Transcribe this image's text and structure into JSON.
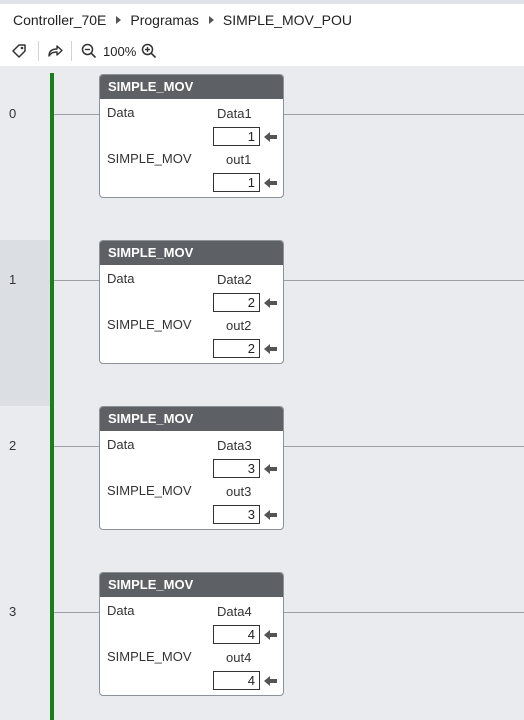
{
  "breadcrumb": [
    "Controller_70E",
    "Programas",
    "SIMPLE_MOV_POU"
  ],
  "toolbar": {
    "zoom": "100%",
    "icons": [
      "tag-icon",
      "go-to-icon",
      "zoom-out-icon",
      "zoom-in-icon"
    ]
  },
  "colors": {
    "rail": "#1a7f1a",
    "block_header": "#5d6064",
    "canvas": "#e9ebee"
  },
  "rungs": [
    {
      "number": "0",
      "block": {
        "title": "SIMPLE_MOV",
        "in_label": "Data",
        "name_label": "SIMPLE_MOV",
        "param1": "Data1",
        "value1": "1",
        "param2": "out1",
        "value2": "1"
      }
    },
    {
      "number": "1",
      "block": {
        "title": "SIMPLE_MOV",
        "in_label": "Data",
        "name_label": "SIMPLE_MOV",
        "param1": "Data2",
        "value1": "2",
        "param2": "out2",
        "value2": "2"
      }
    },
    {
      "number": "2",
      "block": {
        "title": "SIMPLE_MOV",
        "in_label": "Data",
        "name_label": "SIMPLE_MOV",
        "param1": "Data3",
        "value1": "3",
        "param2": "out3",
        "value2": "3"
      }
    },
    {
      "number": "3",
      "block": {
        "title": "SIMPLE_MOV",
        "in_label": "Data",
        "name_label": "SIMPLE_MOV",
        "param1": "Data4",
        "value1": "4",
        "param2": "out4",
        "value2": "4"
      }
    }
  ]
}
